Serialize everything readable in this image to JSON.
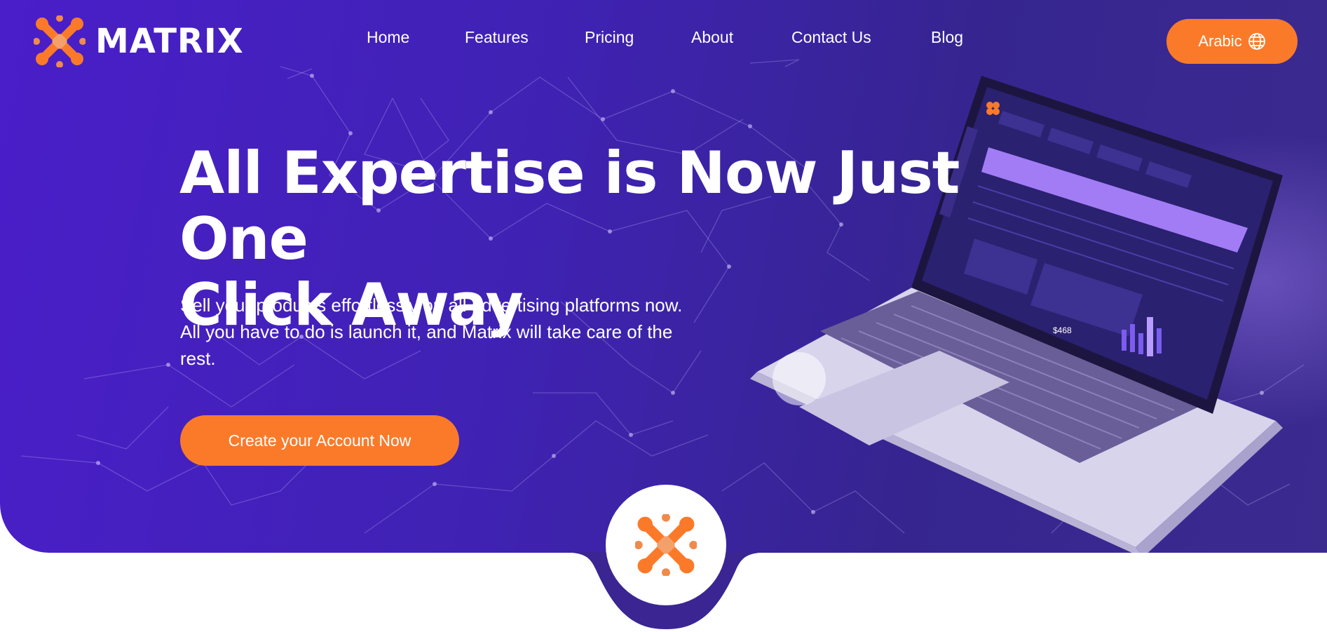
{
  "brand": {
    "name": "MATRIX",
    "logo_icon": "matrix-x-logo-icon",
    "accent_color": "#fb7a2a",
    "hero_color": "#4a1ec9"
  },
  "nav": {
    "items": [
      {
        "label": "Home"
      },
      {
        "label": "Features"
      },
      {
        "label": "Pricing"
      },
      {
        "label": "About"
      },
      {
        "label": "Contact Us"
      },
      {
        "label": "Blog"
      }
    ],
    "language_button": {
      "label": "Arabic",
      "icon": "globe-icon"
    }
  },
  "hero": {
    "headline_line1": "All Expertise is Now Just One",
    "headline_line2": "Click Away",
    "subtext_line1": "Sell your products effortlessly on all advertising platforms now.",
    "subtext_line2": "All you have to do is launch it, and Matrix will take care of the",
    "subtext_line3": "rest.",
    "cta_label": "Create your Account Now"
  },
  "illustration": {
    "laptop_icon": "laptop-dashboard-illustration",
    "dashboard_amount": "$468"
  }
}
